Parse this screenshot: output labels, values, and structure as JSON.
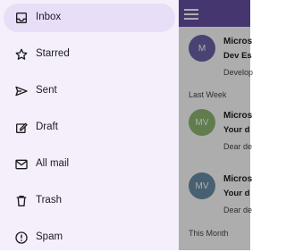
{
  "drawer": {
    "items": [
      {
        "label": "Inbox",
        "icon": "inbox-icon",
        "active": true
      },
      {
        "label": "Starred",
        "icon": "star-icon",
        "active": false
      },
      {
        "label": "Sent",
        "icon": "send-icon",
        "active": false
      },
      {
        "label": "Draft",
        "icon": "edit-icon",
        "active": false
      },
      {
        "label": "All mail",
        "icon": "mail-icon",
        "active": false
      },
      {
        "label": "Trash",
        "icon": "trash-icon",
        "active": false
      },
      {
        "label": "Spam",
        "icon": "spam-icon",
        "active": false
      }
    ]
  },
  "list": {
    "sections": {
      "last_week": "Last Week",
      "this_month": "This Month"
    },
    "emails": [
      {
        "avatar": "M",
        "sender": "Micros",
        "subject": "Dev Es",
        "preview": "Develop",
        "color": "#6a63a8"
      },
      {
        "avatar": "MV",
        "sender": "Micros",
        "subject": "Your d",
        "preview": "Dear de",
        "color": "#8fb873"
      },
      {
        "avatar": "MV",
        "sender": "Micros",
        "subject": "Your d",
        "preview": "Dear de",
        "color": "#6a8fa8"
      }
    ]
  },
  "colors": {
    "topbar": "#6750a4",
    "drawer": "#f4effa",
    "active_indicator": "#e8def8"
  }
}
